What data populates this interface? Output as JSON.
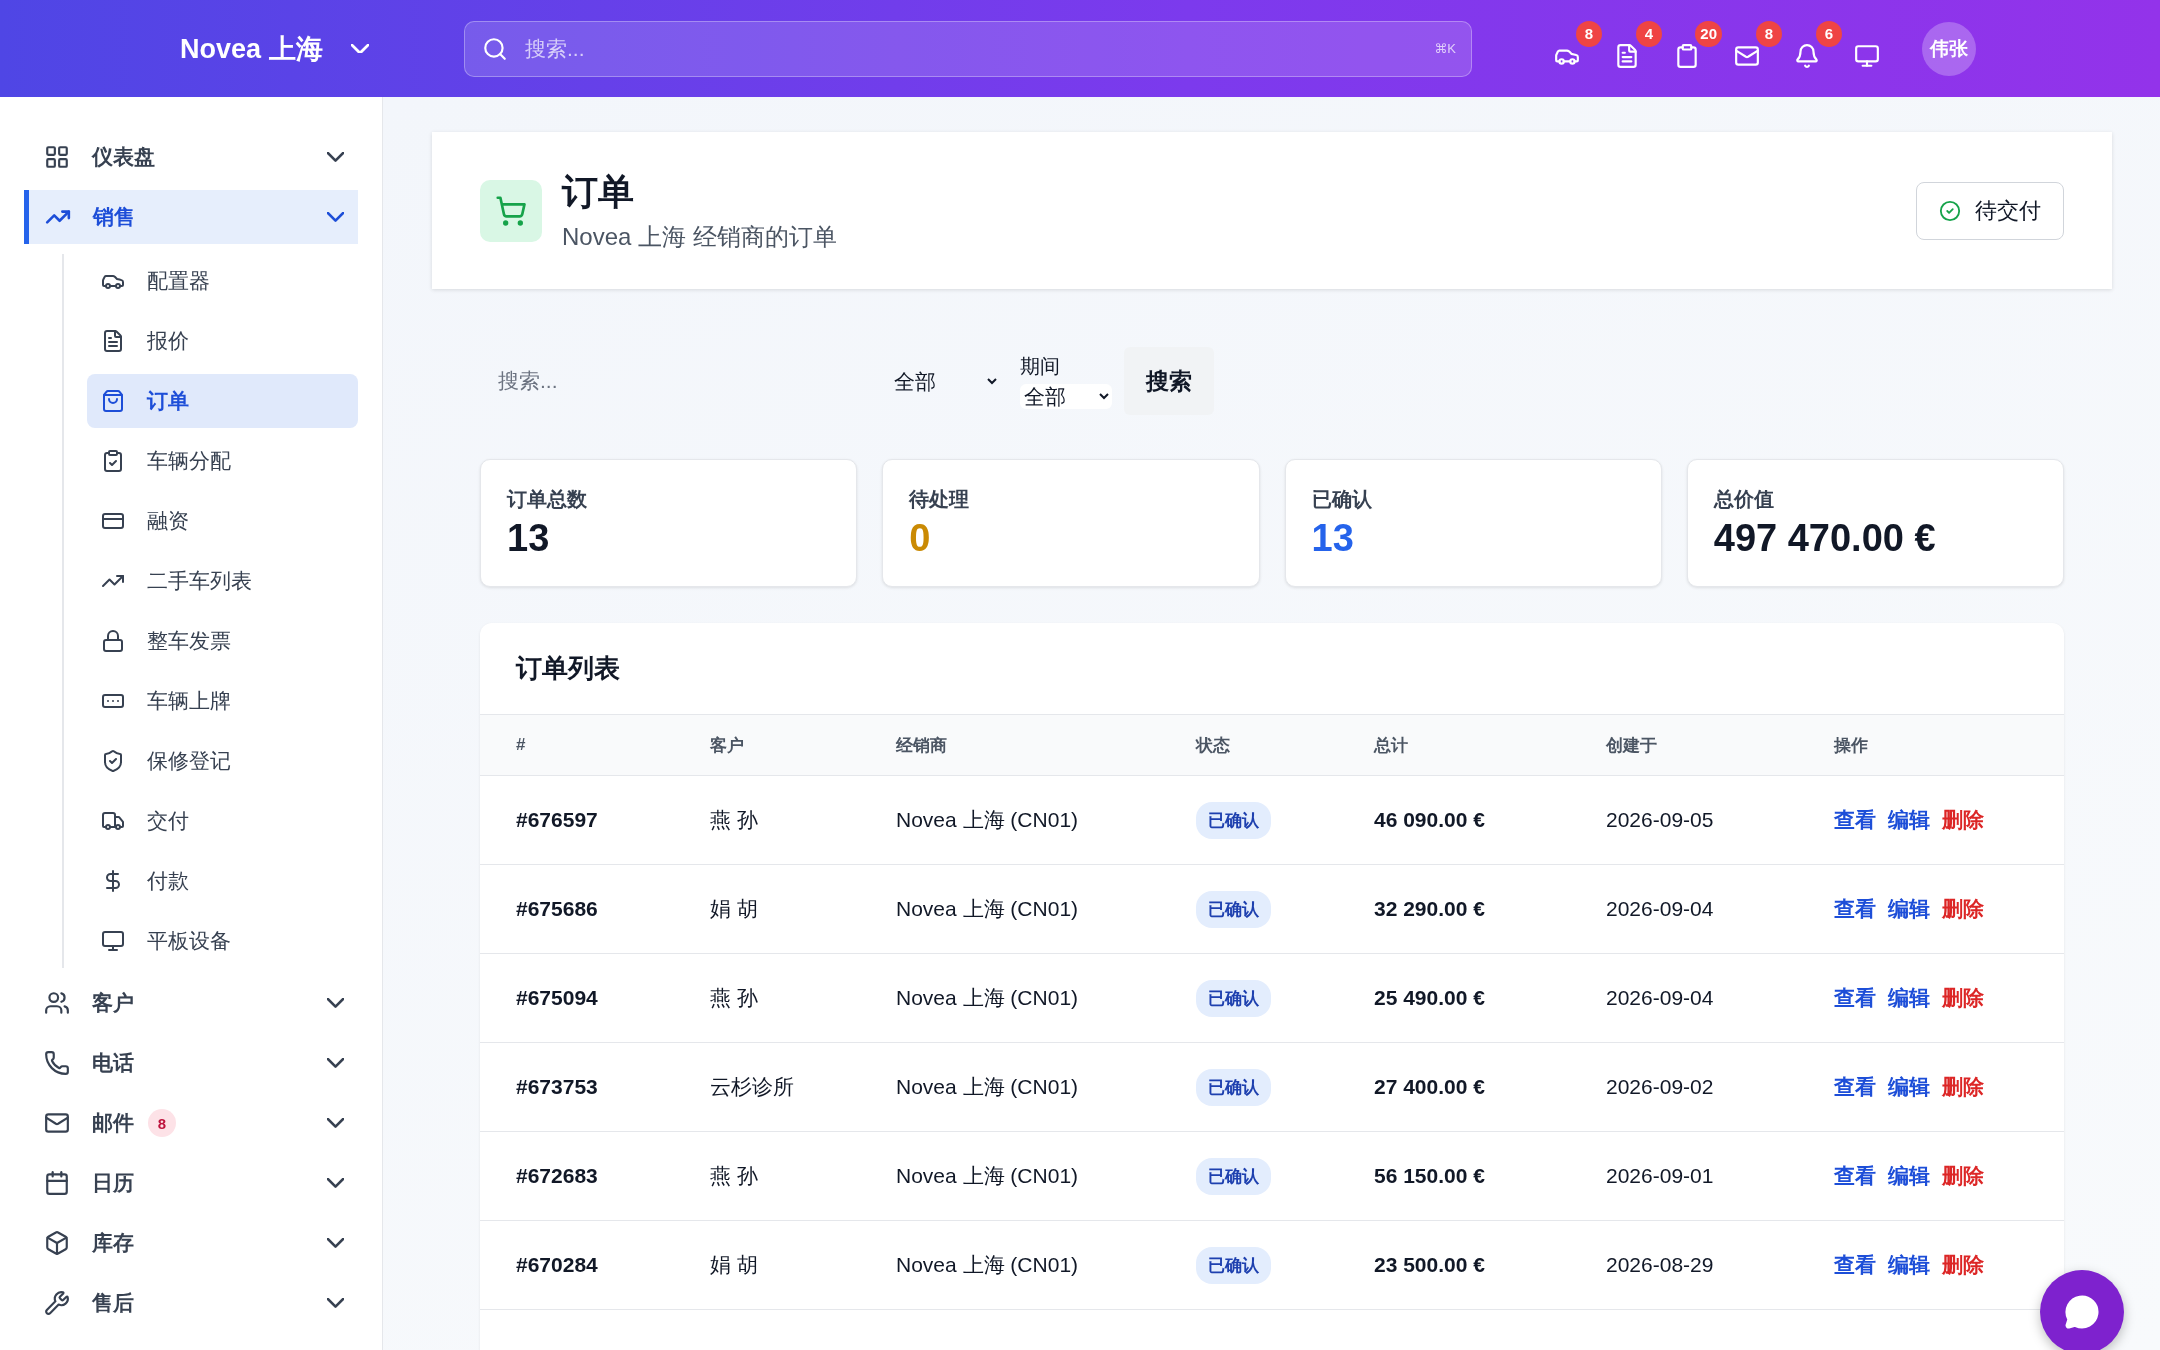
{
  "header": {
    "brand": "Novea 上海",
    "search_placeholder": "搜索...",
    "shortcut": "⌘K",
    "notifications": [
      {
        "count": "8"
      },
      {
        "count": "4"
      },
      {
        "count": "20"
      },
      {
        "count": "8"
      },
      {
        "count": "6"
      }
    ],
    "avatar": "伟张"
  },
  "sidebar": {
    "items": [
      {
        "label": "仪表盘",
        "selected": false
      },
      {
        "label": "销售",
        "selected": true,
        "children": [
          {
            "label": "配置器",
            "selected": false
          },
          {
            "label": "报价",
            "selected": false
          },
          {
            "label": "订单",
            "selected": true
          },
          {
            "label": "车辆分配",
            "selected": false
          },
          {
            "label": "融资",
            "selected": false
          },
          {
            "label": "二手车列表",
            "selected": false
          },
          {
            "label": "整车发票",
            "selected": false
          },
          {
            "label": "车辆上牌",
            "selected": false
          },
          {
            "label": "保修登记",
            "selected": false
          },
          {
            "label": "交付",
            "selected": false
          },
          {
            "label": "付款",
            "selected": false
          },
          {
            "label": "平板设备",
            "selected": false
          }
        ]
      },
      {
        "label": "客户",
        "selected": false
      },
      {
        "label": "电话",
        "selected": false
      },
      {
        "label": "邮件",
        "selected": false,
        "badge": "8"
      },
      {
        "label": "日历",
        "selected": false
      },
      {
        "label": "库存",
        "selected": false
      },
      {
        "label": "售后",
        "selected": false
      }
    ]
  },
  "page_header": {
    "title": "订单",
    "subtitle": "Novea 上海 经销商的订单",
    "button": "待交付"
  },
  "filters": {
    "search_placeholder": "搜索...",
    "status_select": "全部",
    "period_label": "期间",
    "period_select": "全部",
    "button": "搜索"
  },
  "stats": [
    {
      "label": "订单总数",
      "value": "13",
      "color": "#111827"
    },
    {
      "label": "待处理",
      "value": "0",
      "color": "#ca8a04"
    },
    {
      "label": "已确认",
      "value": "13",
      "color": "#2563eb"
    },
    {
      "label": "总价值",
      "value": "497 470.00 €",
      "color": "#111827"
    }
  ],
  "table": {
    "title": "订单列表",
    "columns": [
      "#",
      "客户",
      "经销商",
      "状态",
      "总计",
      "创建于",
      "操作"
    ],
    "rows": [
      {
        "id": "#676597",
        "customer": "燕 孙",
        "dealer": "Novea 上海 (CN01)",
        "status": "已确认",
        "total": "46 090.00 €",
        "created": "2026-09-05",
        "actions": [
          {
            "label": "查看",
            "kind": "link"
          },
          {
            "label": "编辑",
            "kind": "link"
          },
          {
            "label": "删除",
            "kind": "danger"
          }
        ]
      },
      {
        "id": "#675686",
        "customer": "娟 胡",
        "dealer": "Novea 上海 (CN01)",
        "status": "已确认",
        "total": "32 290.00 €",
        "created": "2026-09-04",
        "actions": [
          {
            "label": "查看",
            "kind": "link"
          },
          {
            "label": "编辑",
            "kind": "link"
          },
          {
            "label": "删除",
            "kind": "danger"
          }
        ]
      },
      {
        "id": "#675094",
        "customer": "燕 孙",
        "dealer": "Novea 上海 (CN01)",
        "status": "已确认",
        "total": "25 490.00 €",
        "created": "2026-09-04",
        "actions": [
          {
            "label": "查看",
            "kind": "link"
          },
          {
            "label": "编辑",
            "kind": "link"
          },
          {
            "label": "删除",
            "kind": "danger"
          }
        ]
      },
      {
        "id": "#673753",
        "customer": "云杉诊所",
        "dealer": "Novea 上海 (CN01)",
        "status": "已确认",
        "total": "27 400.00 €",
        "created": "2026-09-02",
        "actions": [
          {
            "label": "查看",
            "kind": "link"
          },
          {
            "label": "编辑",
            "kind": "link"
          },
          {
            "label": "删除",
            "kind": "danger"
          }
        ]
      },
      {
        "id": "#672683",
        "customer": "燕 孙",
        "dealer": "Novea 上海 (CN01)",
        "status": "已确认",
        "total": "56 150.00 €",
        "created": "2026-09-01",
        "actions": [
          {
            "label": "查看",
            "kind": "link"
          },
          {
            "label": "编辑",
            "kind": "link"
          },
          {
            "label": "删除",
            "kind": "danger"
          }
        ]
      },
      {
        "id": "#670284",
        "customer": "娟 胡",
        "dealer": "Novea 上海 (CN01)",
        "status": "已确认",
        "total": "23 500.00 €",
        "created": "2026-08-29",
        "actions": [
          {
            "label": "查看",
            "kind": "link"
          },
          {
            "label": "编辑",
            "kind": "link"
          },
          {
            "label": "删除",
            "kind": "danger"
          }
        ]
      }
    ]
  }
}
